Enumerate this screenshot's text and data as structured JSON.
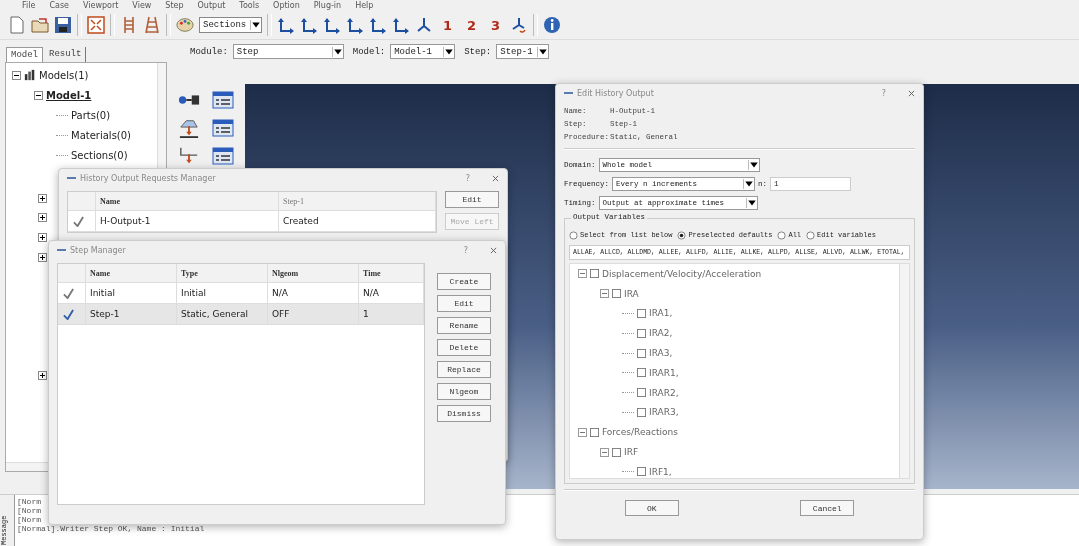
{
  "menu": [
    "File",
    "Case",
    "Viewport",
    "View",
    "Step",
    "Output",
    "Tools",
    "Option",
    "Plug-in",
    "Help"
  ],
  "toolbar": {
    "display_group": "Sections",
    "view_numbers": [
      "1",
      "2",
      "3"
    ]
  },
  "panel_tabs": [
    {
      "label": "Model",
      "selected": true
    },
    {
      "label": "Result",
      "selected": false
    }
  ],
  "context_bar": [
    {
      "label": "Module:",
      "value": "Step"
    },
    {
      "label": "Model:",
      "value": "Model-1"
    },
    {
      "label": "Step:",
      "value": "Step-1"
    }
  ],
  "model_tree": [
    {
      "label": "Models(1)",
      "expanded": true,
      "children": [
        {
          "label": "Model-1",
          "expanded": true,
          "children": [
            {
              "label": "Parts(0)"
            },
            {
              "label": "Materials(0)"
            },
            {
              "label": "Sections(0)"
            }
          ]
        }
      ]
    }
  ],
  "history_manager": {
    "title": "History Output Requests Manager",
    "help": "?",
    "columns": [
      "Name",
      "Step-1"
    ],
    "rows": [
      {
        "cells": [
          "H-Output-1",
          "Created"
        ],
        "selected": false
      }
    ],
    "buttons": [
      {
        "label": "Edit",
        "disabled": false
      },
      {
        "label": "Move Left",
        "disabled": true
      }
    ]
  },
  "step_manager": {
    "title": "Step Manager",
    "help": "?",
    "columns": [
      "Name",
      "Type",
      "Nlgeom",
      "Time"
    ],
    "rows": [
      {
        "cells": [
          "Initial",
          "Initial",
          "N/A",
          "N/A"
        ],
        "selected": false
      },
      {
        "cells": [
          "Step-1",
          "Static, General",
          "OFF",
          "1"
        ],
        "selected": true
      }
    ],
    "buttons": [
      "Create",
      "Edit",
      "Rename",
      "Delete",
      "Replace",
      "Nlgeom",
      "Dismiss"
    ]
  },
  "edit_history": {
    "title": "Edit History Output",
    "help": "?",
    "info": [
      {
        "label": "Name:",
        "value": "H-Output-1"
      },
      {
        "label": "Step:",
        "value": "Step-1"
      },
      {
        "label": "Procedure:",
        "value": "Static, General"
      }
    ],
    "domain": {
      "label": "Domain:",
      "value": "Whole model"
    },
    "frequency": {
      "label": "Frequency:",
      "value": "Every n increments",
      "n_label": "n:",
      "n_value": "1"
    },
    "timing": {
      "label": "Timing:",
      "value": "Output at approximate times"
    },
    "group_title": "Output Variables",
    "radios": [
      {
        "label": "Select from list below",
        "selected": false
      },
      {
        "label": "Preselected defaults",
        "selected": true
      },
      {
        "label": "All",
        "selected": false
      },
      {
        "label": "Edit variables",
        "selected": false
      }
    ],
    "variables": "ALLAE, ALLCD, ALLDMD, ALLEE, ALLFD, ALLIE, ALLKE, ALLPD, ALLSE, ALLVD, ALLWK, ETOTAL,",
    "tree": [
      {
        "label": "Displacement/Velocity/Acceleration",
        "checked": false,
        "expanded": true,
        "children": [
          {
            "label": "IRA",
            "checked": false,
            "expanded": true,
            "children": [
              {
                "label": "IRA1,",
                "checked": false
              },
              {
                "label": "IRA2,",
                "checked": false
              },
              {
                "label": "IRA3,",
                "checked": false
              },
              {
                "label": "IRAR1,",
                "checked": false
              },
              {
                "label": "IRAR2,",
                "checked": false
              },
              {
                "label": "IRAR3,",
                "checked": false
              }
            ]
          }
        ]
      },
      {
        "label": "Forces/Reactions",
        "checked": false,
        "expanded": true,
        "children": [
          {
            "label": "IRF",
            "checked": false,
            "expanded": true,
            "children": [
              {
                "label": "IRF1,",
                "checked": false
              }
            ]
          }
        ]
      }
    ],
    "buttons": [
      "OK",
      "Cancel"
    ]
  },
  "message_tab": "Message",
  "messages": [
    "[Norm",
    "[Norm",
    "[Norm",
    "[Normal].Writer Step OK, Name : Initial"
  ]
}
